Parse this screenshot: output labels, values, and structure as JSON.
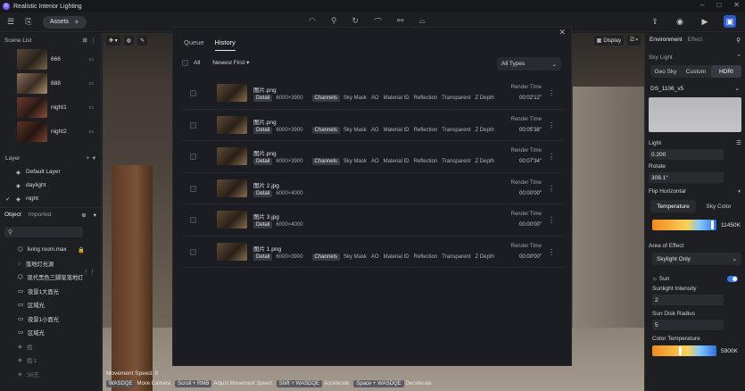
{
  "app": {
    "title": "Realistic Interior Lighting",
    "logo_letter": "R"
  },
  "window_controls": [
    "–",
    "□",
    "✕"
  ],
  "toolbar": {
    "assets_label": "Assets"
  },
  "left": {
    "scene_list_title": "Scene List",
    "scenes": [
      {
        "name": "666"
      },
      {
        "name": "888"
      },
      {
        "name": "night1"
      },
      {
        "name": "night2"
      }
    ],
    "layer_title": "Layer",
    "layers": [
      {
        "name": "Default Layer",
        "check": ""
      },
      {
        "name": "daylight",
        "check": ""
      },
      {
        "name": "night",
        "check": "✓"
      }
    ],
    "object_tab": "Object",
    "imported_tab": "Imported",
    "objects": [
      {
        "name": "living room.max"
      },
      {
        "name": "落地灯光源"
      },
      {
        "name": "现代黑色三脚架落地灯"
      },
      {
        "name": "夜景1大面光"
      },
      {
        "name": "区域光"
      },
      {
        "name": "夜景1小面光"
      },
      {
        "name": "区域光"
      },
      {
        "name": "组"
      },
      {
        "name": "组 1"
      },
      {
        "name": "S6艺"
      }
    ],
    "movement_speed": "Movement Speed: 5"
  },
  "viewport": {
    "display_label": "Display"
  },
  "modal": {
    "tabs": [
      "Queue",
      "History"
    ],
    "filter_all": "All",
    "sort": "Newest First",
    "type_filter": "All Types",
    "detail_label": "Detail",
    "channels_label": "Channels",
    "render_time_label": "Render Time",
    "rows": [
      {
        "name": "图片.png",
        "res": "6000×3900",
        "channels": [
          "Sky Mask",
          "AO",
          "Material ID",
          "Reflection",
          "Transparent",
          "Z Depth"
        ],
        "time": "00:02'12\""
      },
      {
        "name": "图片.png",
        "res": "6000×3900",
        "channels": [
          "Sky Mask",
          "AO",
          "Material ID",
          "Reflection",
          "Transparent",
          "Z Depth"
        ],
        "time": "00:05'38\""
      },
      {
        "name": "图片.png",
        "res": "6000×3900",
        "channels": [
          "Sky Mask",
          "AO",
          "Material ID",
          "Reflection",
          "Transparent",
          "Z Depth"
        ],
        "time": "00:07'34\""
      },
      {
        "name": "图片 2.jpg",
        "res": "6000×4000",
        "channels": [],
        "time": "00:00'00\""
      },
      {
        "name": "图片 3.jpg",
        "res": "6000×4000",
        "channels": [],
        "time": "00:00'00\""
      },
      {
        "name": "图片 1.png",
        "res": "6000×3900",
        "channels": [
          "Sky Mask",
          "AO",
          "Material ID",
          "Reflection",
          "Transparent",
          "Z Depth"
        ],
        "time": "00:00'00\""
      }
    ]
  },
  "hints": [
    {
      "key": "WASDQE",
      "label": "Move Camera"
    },
    {
      "key": "Scroll + RMB",
      "label": "Adjust Movement Speed"
    },
    {
      "key": "Shift + WASDQE",
      "label": "Accelerate"
    },
    {
      "key": "Space + WASDQE",
      "label": "Decelerate"
    }
  ],
  "right": {
    "tab_environment": "Environment",
    "tab_effect": "Effect",
    "sky_light": "Sky Light",
    "sky_modes": [
      "Geo Sky",
      "Custom",
      "HDRI"
    ],
    "hdri_name": "DS_1106_v5",
    "light_label": "Light",
    "light_value": "0.200",
    "rotate_label": "Rotate",
    "rotate_value": "308.1°",
    "flip_label": "Flip Horizontal",
    "tabs2": [
      "Temperature",
      "Sky Color"
    ],
    "temp_value": "11450K",
    "area_label": "Area of Effect",
    "area_value": "Skylight Only",
    "sun_label": "Sun",
    "sun_intensity_label": "Sunlight Intensity",
    "sun_intensity_value": "2",
    "disk_label": "Sun Disk Radius",
    "disk_value": "5",
    "color_temp_label": "Color Temperature",
    "color_temp_value": "5900K",
    "accent": "#2b5cc9"
  }
}
